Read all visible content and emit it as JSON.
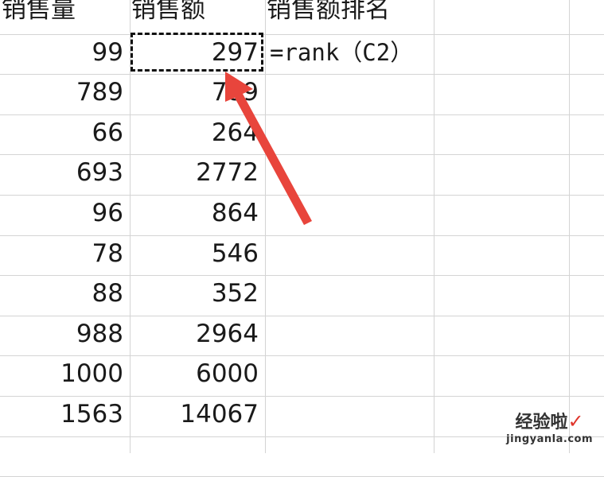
{
  "headers": [
    "销售量",
    "销售额",
    "销售额排名"
  ],
  "rows": [
    {
      "qty": "99",
      "amount": "297"
    },
    {
      "qty": "789",
      "amount": "789"
    },
    {
      "qty": "66",
      "amount": "264"
    },
    {
      "qty": "693",
      "amount": "2772"
    },
    {
      "qty": "96",
      "amount": "864"
    },
    {
      "qty": "78",
      "amount": "546"
    },
    {
      "qty": "88",
      "amount": "352"
    },
    {
      "qty": "988",
      "amount": "2964"
    },
    {
      "qty": "1000",
      "amount": "6000"
    },
    {
      "qty": "1563",
      "amount": "14067"
    }
  ],
  "formula": "=rank（C2）",
  "colors": {
    "grid": "#d4d4d4",
    "arrow": "#e8453c",
    "text": "#1a1a1a"
  },
  "watermark": {
    "name": "经验啦",
    "url": "jingyanla.com"
  },
  "icons": {
    "selection": "dashed-marquee",
    "arrow": "red-arrow-pointer",
    "check": "checkmark-icon"
  }
}
